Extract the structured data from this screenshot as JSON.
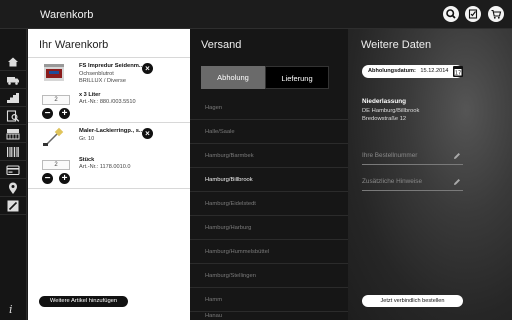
{
  "app": {
    "title": "Warenkorb",
    "top_icons": [
      "search-icon",
      "checklist-icon",
      "cart-icon"
    ]
  },
  "sidenav": {
    "items": [
      "home-icon",
      "truck-icon",
      "stairs-icon",
      "search-list-icon",
      "wallpaper-roll-icon",
      "barcode-icon",
      "card-icon",
      "location-pin-icon",
      "brush-slash-icon"
    ],
    "info_label": "i"
  },
  "cart": {
    "title": "Ihr Warenkorb",
    "items": [
      {
        "name": "FS Impredur Seidenm...",
        "line1": "Ochsenblutrot",
        "line2": "BRILLUX / Diverse",
        "quantity": "2",
        "unit_label": "x 3 Liter",
        "article_number": "Art.-Nr.: 880./003.5510",
        "delete_label": "×",
        "minus_label": "−",
        "plus_label": "+"
      },
      {
        "name": "Maler-Lackierringp., s...",
        "line1": "Gr. 10",
        "quantity": "2",
        "unit_label": "Stück",
        "article_number": "Art.-Nr.: 1178.0010.0",
        "delete_label": "×",
        "minus_label": "−",
        "plus_label": "+"
      }
    ],
    "add_more_label": "Weitere Artikel hinzufügen"
  },
  "versand": {
    "title": "Versand",
    "tabs": [
      {
        "label": "Abholung",
        "active": true
      },
      {
        "label": "Lieferung",
        "active": false
      }
    ],
    "branches": [
      {
        "label": "Hagen",
        "selected": false
      },
      {
        "label": "Halle/Saale",
        "selected": false
      },
      {
        "label": "Hamburg/Barmbek",
        "selected": false
      },
      {
        "label": "Hamburg/Billbrook",
        "selected": true
      },
      {
        "label": "Hamburg/Eidelstedt",
        "selected": false
      },
      {
        "label": "Hamburg/Harburg",
        "selected": false
      },
      {
        "label": "Hamburg/Hummelsbüttel",
        "selected": false
      },
      {
        "label": "Hamburg/Stellingen",
        "selected": false
      },
      {
        "label": "Hamm",
        "selected": false
      },
      {
        "label": "Hanau",
        "selected": false
      }
    ]
  },
  "weitere": {
    "title": "Weitere Daten",
    "date_label": "Abholungsdatum:",
    "date_value": "15.12.2014",
    "branch_heading": "Niederlassung",
    "branch_name": "DE Hamburg/Billbrook",
    "branch_street": "Bredowstraße 12",
    "fields": [
      {
        "placeholder": "Ihre Bestellnummer"
      },
      {
        "placeholder": "Zusätzliche Hinweise"
      }
    ],
    "order_label": "Jetzt verbindlich bestellen"
  },
  "colors": {
    "cart_bg": "#ffffff",
    "dark_bg": "#161616",
    "active_tab": "#6a6a6a",
    "inactive_branch_text": "#7a7a7a"
  }
}
